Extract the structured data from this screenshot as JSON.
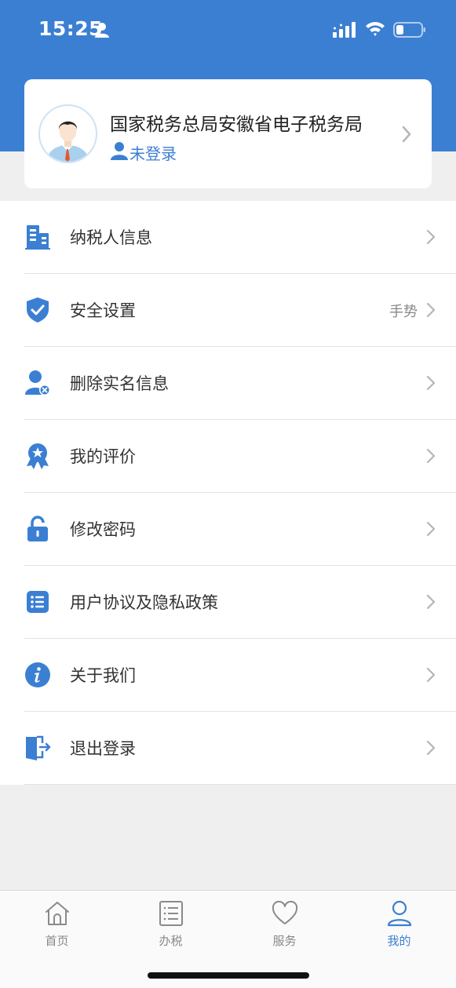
{
  "status_bar": {
    "time": "15:25"
  },
  "profile": {
    "title": "国家税务总局安徽省电子税务局",
    "login_status": "未登录"
  },
  "menu": [
    {
      "label": "纳税人信息",
      "icon": "building-icon",
      "value": ""
    },
    {
      "label": "安全设置",
      "icon": "shield-check-icon",
      "value": "手势"
    },
    {
      "label": "删除实名信息",
      "icon": "user-remove-icon",
      "value": ""
    },
    {
      "label": "我的评价",
      "icon": "award-star-icon",
      "value": ""
    },
    {
      "label": "修改密码",
      "icon": "unlock-icon",
      "value": ""
    },
    {
      "label": "用户协议及隐私政策",
      "icon": "list-document-icon",
      "value": ""
    },
    {
      "label": "关于我们",
      "icon": "info-icon",
      "value": ""
    },
    {
      "label": "退出登录",
      "icon": "logout-door-icon",
      "value": ""
    }
  ],
  "tabs": [
    {
      "label": "首页",
      "icon": "home-icon",
      "active": false
    },
    {
      "label": "办税",
      "icon": "document-list-icon",
      "active": false
    },
    {
      "label": "服务",
      "icon": "heart-icon",
      "active": false
    },
    {
      "label": "我的",
      "icon": "person-icon",
      "active": true
    }
  ],
  "colors": {
    "primary": "#3b7fd3",
    "background": "#efefef",
    "text": "#333333",
    "muted": "#888888"
  }
}
